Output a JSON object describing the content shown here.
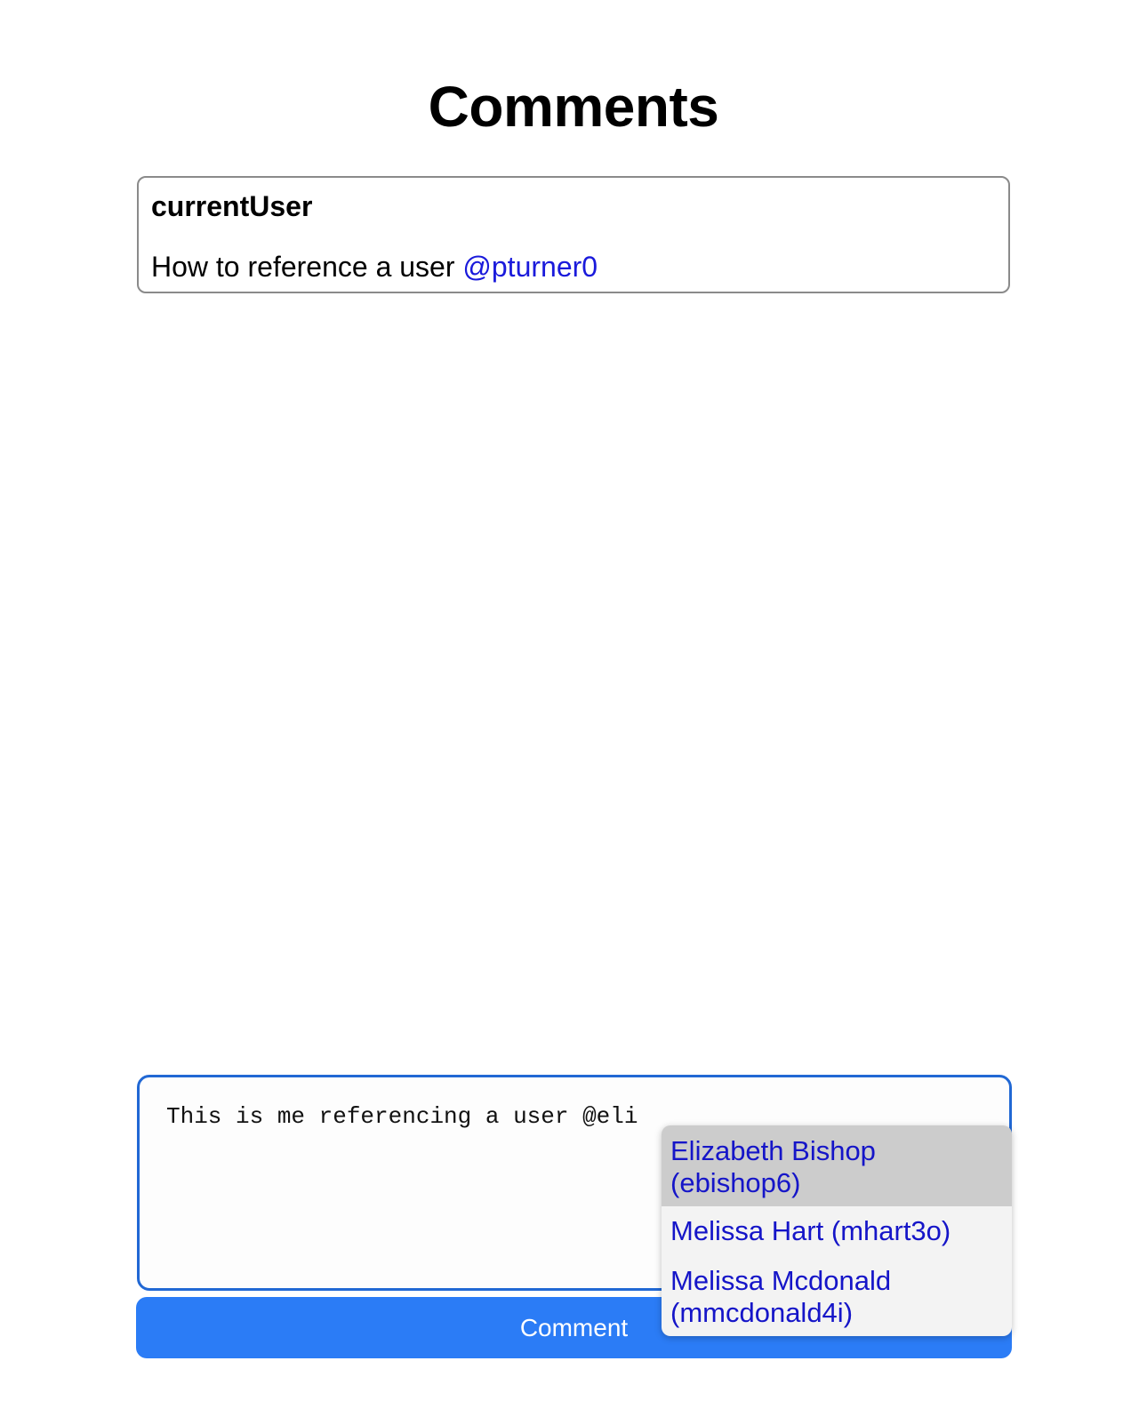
{
  "page": {
    "title": "Comments"
  },
  "comments": [
    {
      "author": "currentUser",
      "text": "How to reference a user ",
      "mention": "@pturner0"
    }
  ],
  "composer": {
    "value": "This is me referencing a user @eli",
    "submit_label": "Comment"
  },
  "suggestions": [
    {
      "label": "Elizabeth Bishop (ebishop6)",
      "highlighted": true
    },
    {
      "label": "Melissa Hart (mhart3o)",
      "highlighted": false
    },
    {
      "label": "Melissa Mcdonald (mmcdonald4i)",
      "highlighted": false
    }
  ],
  "colors": {
    "accent": "#2b7cf6",
    "focus_border": "#2168d4",
    "mention": "#1a1adb",
    "highlight": "#cccccc"
  }
}
